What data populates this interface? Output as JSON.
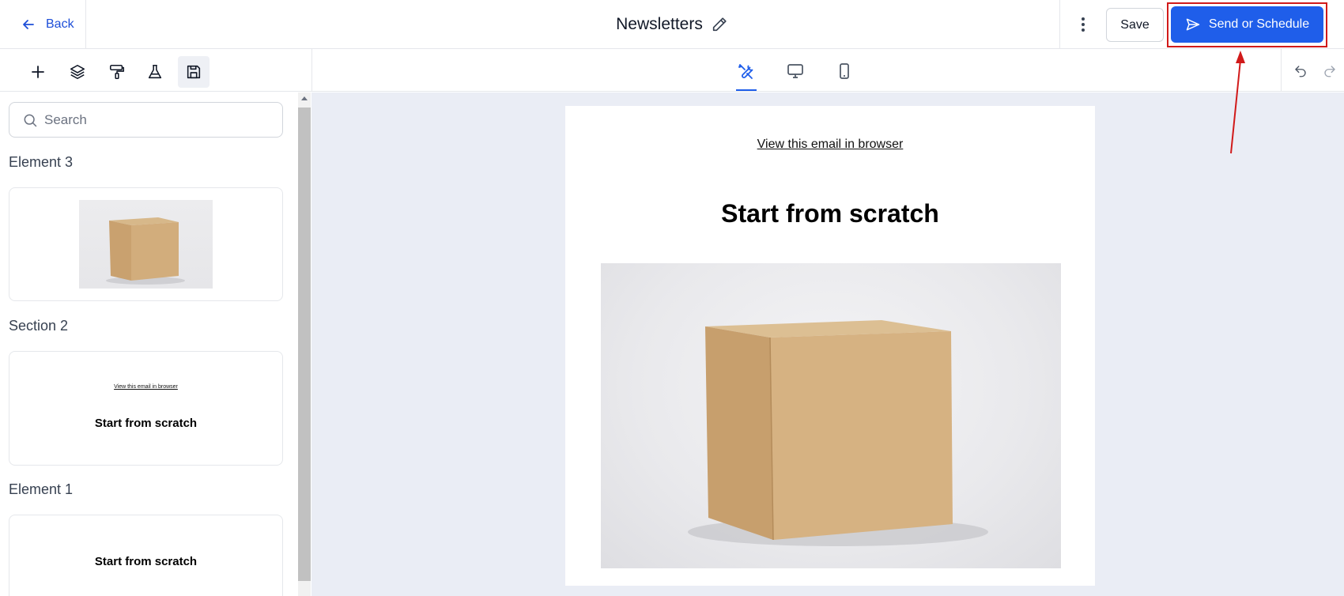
{
  "header": {
    "back_label": "Back",
    "title": "Newsletters",
    "save_label": "Save",
    "send_label": "Send or Schedule"
  },
  "sidebar": {
    "search_placeholder": "Search",
    "sections": [
      {
        "label": "Element 3"
      },
      {
        "label": "Section 2",
        "link": "View this email in browser",
        "heading": "Start from scratch"
      },
      {
        "label": "Element 1",
        "heading": "Start from scratch"
      }
    ]
  },
  "email": {
    "link": "View this email in browser",
    "heading": "Start from scratch"
  },
  "colors": {
    "accent": "#1f5eea",
    "highlight": "#d11a1a",
    "canvas_bg": "#eaedf5"
  },
  "icons": [
    "arrow-left-icon",
    "pencil-icon",
    "kebab-icon",
    "send-icon",
    "plus-icon",
    "layers-icon",
    "paint-roller-icon",
    "flask-icon",
    "floppy-disk-icon",
    "tools-icon",
    "desktop-icon",
    "mobile-icon",
    "undo-icon",
    "redo-icon",
    "search-icon"
  ]
}
